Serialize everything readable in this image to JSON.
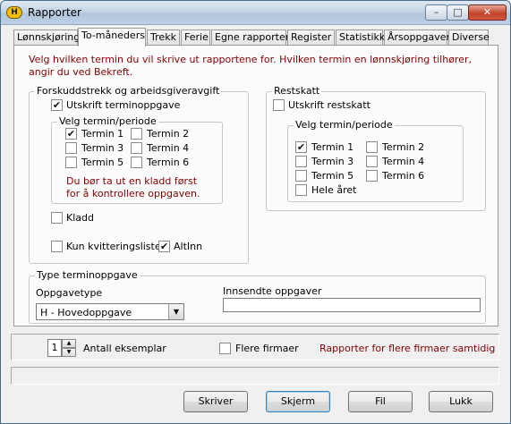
{
  "window": {
    "title": "Rapporter",
    "logo_text": "H"
  },
  "tabs": [
    {
      "label": "Lønnskjøring",
      "active": false
    },
    {
      "label": "To-måneders",
      "active": true
    },
    {
      "label": "Trekk",
      "active": false
    },
    {
      "label": "Ferie",
      "active": false
    },
    {
      "label": "Egne rapporter",
      "active": false
    },
    {
      "label": "Register",
      "active": false
    },
    {
      "label": "Statistikk",
      "active": false
    },
    {
      "label": "Årsoppgaver",
      "active": false
    },
    {
      "label": "Diverse",
      "active": false
    }
  ],
  "intro": "Velg hvilken termin du vil skrive ut rapportene for. Hvilken termin en lønnskjøring tilhører, angir du ved Bekreft.",
  "forskudd": {
    "legend": "Forskuddstrekk og arbeidsgiveravgift",
    "utskrift": {
      "label": "Utskrift terminoppgave",
      "checked": true
    },
    "termin_legend": "Velg termin/periode",
    "terms": [
      {
        "label": "Termin 1",
        "checked": true
      },
      {
        "label": "Termin 2",
        "checked": false
      },
      {
        "label": "Termin 3",
        "checked": false
      },
      {
        "label": "Termin 4",
        "checked": false
      },
      {
        "label": "Termin 5",
        "checked": false
      },
      {
        "label": "Termin 6",
        "checked": false
      }
    ],
    "warning": "Du bør ta ut en kladd først for å kontrollere oppgaven.",
    "kladd": {
      "label": "Kladd",
      "checked": false
    },
    "kvittering": {
      "label": "Kun kvitteringsliste",
      "checked": false
    },
    "altinn": {
      "label": "AltInn",
      "checked": true
    }
  },
  "restskatt": {
    "legend": "Restskatt",
    "utskrift": {
      "label": "Utskrift restskatt",
      "checked": false
    },
    "termin_legend": "Velg termin/periode",
    "terms": [
      {
        "label": "Termin 1",
        "checked": true
      },
      {
        "label": "Termin 2",
        "checked": false
      },
      {
        "label": "Termin 3",
        "checked": false
      },
      {
        "label": "Termin 4",
        "checked": false
      },
      {
        "label": "Termin 5",
        "checked": false
      },
      {
        "label": "Termin 6",
        "checked": false
      },
      {
        "label": "Hele året",
        "checked": false
      }
    ]
  },
  "type_termin": {
    "legend": "Type terminoppgave",
    "oppgavetype_label": "Oppgavetype",
    "oppgavetype_value": "H - Hovedoppgave",
    "innsendte_label": "Innsendte oppgaver",
    "innsendte_value": ""
  },
  "bottom": {
    "antall_value": "1",
    "antall_label": "Antall eksemplar",
    "flere_firmaer": {
      "label": "Flere firmaer",
      "checked": false
    },
    "flere_note": "Rapporter for flere firmaer samtidig"
  },
  "buttons": {
    "skriver": "Skriver",
    "skjerm": "Skjerm",
    "fil": "Fil",
    "lukk": "Lukk"
  },
  "colors": {
    "note_red": "#800000",
    "title_gradient": "#c3d4e6"
  },
  "icons": [
    "minimize-icon",
    "maximize-icon",
    "close-icon",
    "dropdown-arrow-icon",
    "spin-up-icon",
    "spin-down-icon",
    "check-icon"
  ]
}
